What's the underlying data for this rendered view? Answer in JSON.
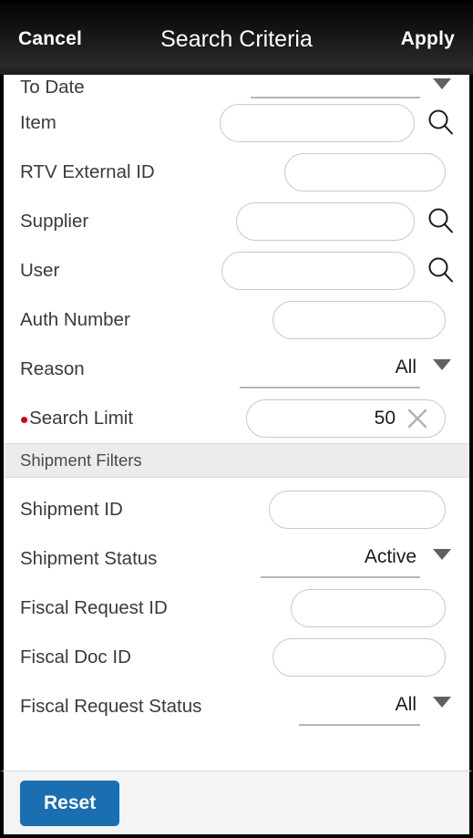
{
  "header": {
    "cancel_label": "Cancel",
    "title": "Search Criteria",
    "apply_label": "Apply"
  },
  "form": {
    "fields": [
      {
        "label": "To Date",
        "type": "dropdown",
        "value": "",
        "icon": "chevron-down-icon",
        "clipped": true
      },
      {
        "label": "Item",
        "type": "text",
        "value": "",
        "icon": "search-icon"
      },
      {
        "label": "RTV External ID",
        "type": "text",
        "value": "",
        "icon": ""
      },
      {
        "label": "Supplier",
        "type": "text",
        "value": "",
        "icon": "search-icon"
      },
      {
        "label": "User",
        "type": "text",
        "value": "",
        "icon": "search-icon"
      },
      {
        "label": "Auth Number",
        "type": "text",
        "value": "",
        "icon": ""
      },
      {
        "label": "Reason",
        "type": "dropdown",
        "value": "All",
        "icon": "chevron-down-icon"
      },
      {
        "label": "Search Limit",
        "type": "text",
        "value": "50",
        "icon": "clear-icon",
        "required": true
      }
    ],
    "section": {
      "label": "Shipment Filters"
    },
    "shipment_fields": [
      {
        "label": "Shipment ID",
        "type": "text",
        "value": "",
        "icon": ""
      },
      {
        "label": "Shipment Status",
        "type": "dropdown",
        "value": "Active",
        "icon": "chevron-down-icon"
      },
      {
        "label": "Fiscal Request ID",
        "type": "text",
        "value": "",
        "icon": ""
      },
      {
        "label": "Fiscal Doc ID",
        "type": "text",
        "value": "",
        "icon": ""
      },
      {
        "label": "Fiscal Request Status",
        "type": "dropdown",
        "value": "All",
        "icon": "chevron-down-icon"
      }
    ]
  },
  "footer": {
    "reset_label": "Reset"
  },
  "colors": {
    "accent": "#1b6fb0",
    "header_bg": "#141414",
    "required": "#d0021b",
    "section_bg": "#ececec",
    "footer_bg": "#f4f4f4"
  }
}
